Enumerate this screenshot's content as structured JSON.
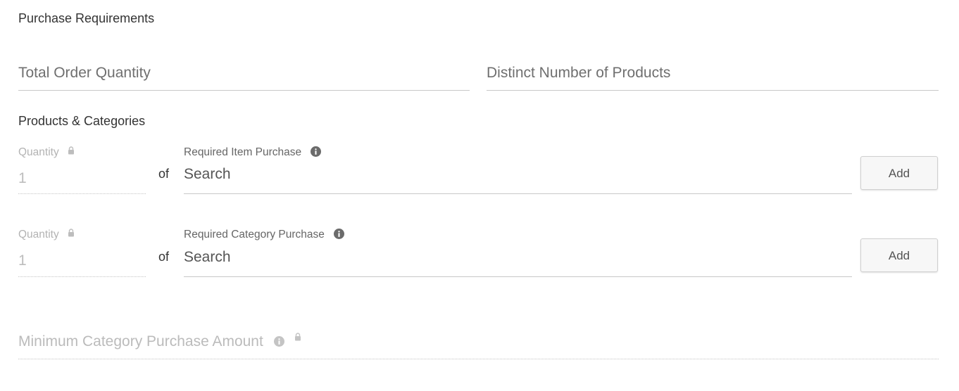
{
  "purchase_requirements": {
    "title": "Purchase Requirements",
    "total_order_quantity_placeholder": "Total Order Quantity",
    "distinct_products_placeholder": "Distinct Number of Products"
  },
  "products_categories": {
    "title": "Products & Categories",
    "rows": [
      {
        "quantity_label": "Quantity",
        "quantity_value": "1",
        "of_text": "of",
        "required_label": "Required Item Purchase",
        "search_placeholder": "Search",
        "add_label": "Add"
      },
      {
        "quantity_label": "Quantity",
        "quantity_value": "1",
        "of_text": "of",
        "required_label": "Required Category Purchase",
        "search_placeholder": "Search",
        "add_label": "Add"
      }
    ]
  },
  "minimum_category_purchase": {
    "label": "Minimum Category Purchase Amount"
  },
  "icons": {
    "lock": "lock-icon",
    "info": "info-icon"
  },
  "colors": {
    "text_dark": "#333333",
    "text_placeholder": "#6f6f6f",
    "text_disabled": "#bbbbbb",
    "icon_gray": "#6b6b6b",
    "underline": "#c8c8c8",
    "button_bg": "#f7f7f7"
  }
}
